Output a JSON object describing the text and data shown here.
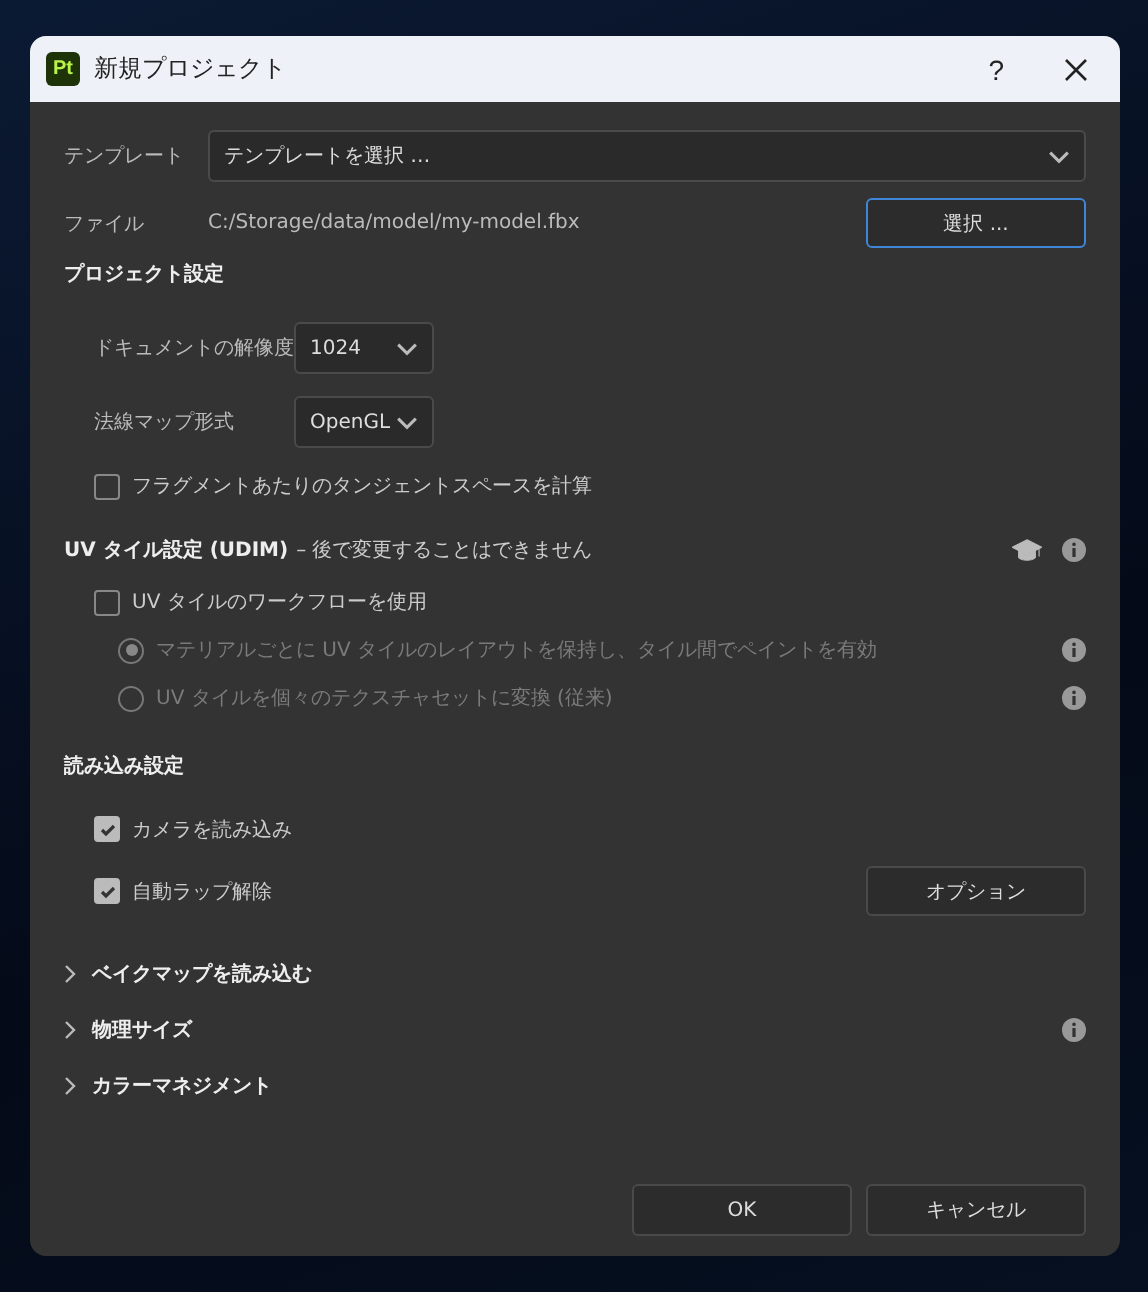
{
  "window": {
    "badge": "Pt",
    "title": "新規プロジェクト",
    "help": "?"
  },
  "template": {
    "label": "テンプレート",
    "value": "テンプレートを選択 …"
  },
  "file": {
    "label": "ファイル",
    "path": "C:/Storage/data/model/my-model.fbx",
    "button": "選択 ..."
  },
  "project_settings": {
    "heading": "プロジェクト設定",
    "selects": [
      {
        "label": "ドキュメントの解像度",
        "value": "1024"
      },
      {
        "label": "法線マップ形式",
        "value": "OpenGL"
      }
    ],
    "checkbox": {
      "label": "フラグメントあたりのタンジェントスペースを計算",
      "checked": false
    }
  },
  "uv_tiles": {
    "heading": "UV タイル設定 (UDIM)",
    "note": "– 後で変更することはできません",
    "checkbox": {
      "label": "UV タイルのワークフローを使用",
      "checked": false
    },
    "options": [
      {
        "label": "マテリアルごとに UV タイルのレイアウトを保持し、タイル間でペイントを有効",
        "selected": true,
        "disabled": true
      },
      {
        "label": "UV タイルを個々のテクスチャセットに変換 (従来)",
        "selected": false,
        "disabled": true
      }
    ]
  },
  "import_settings": {
    "heading": "読み込み設定",
    "checkboxes": [
      {
        "label": "カメラを読み込み",
        "checked": true
      },
      {
        "label": "自動ラップ解除",
        "checked": true,
        "button": "オプション"
      }
    ]
  },
  "sections": [
    {
      "label": "ベイクマップを読み込む",
      "expanded": false,
      "info": false
    },
    {
      "label": "物理サイズ",
      "expanded": false,
      "info": true
    },
    {
      "label": "カラーマネジメント",
      "expanded": false,
      "info": false
    }
  ],
  "buttons": [
    "OK",
    "キャンセル"
  ]
}
